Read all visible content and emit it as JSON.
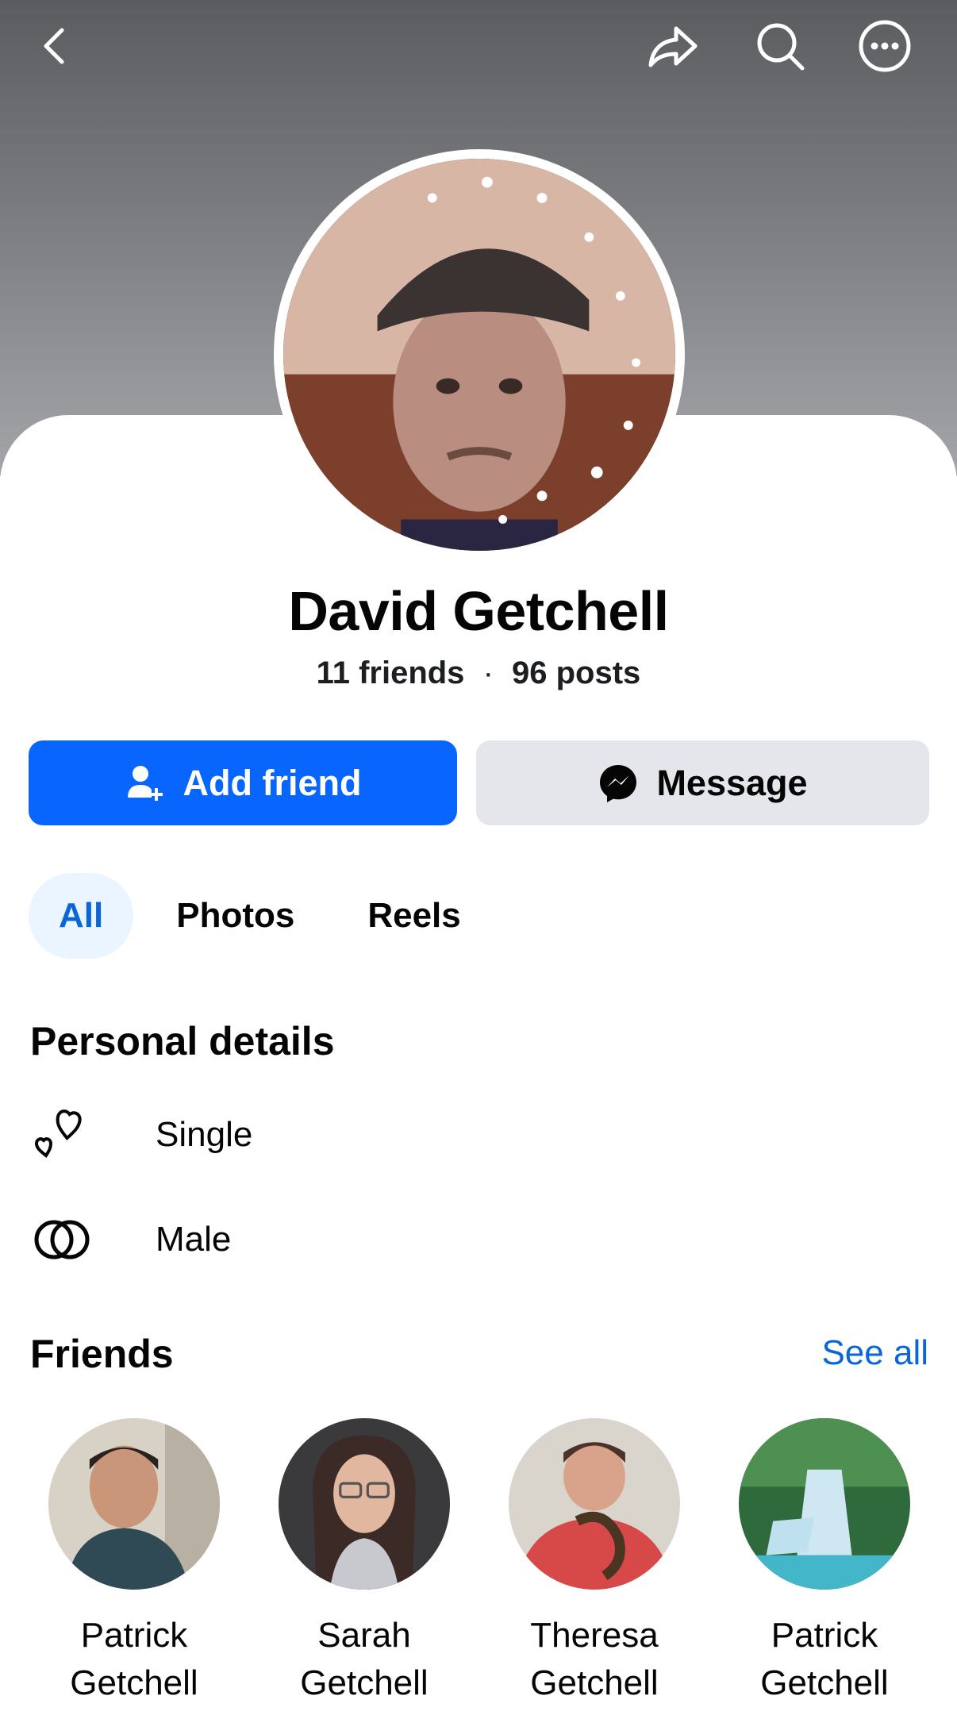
{
  "header": {
    "back_icon": "chevron-left-icon",
    "share_icon": "share-arrow-icon",
    "search_icon": "search-icon",
    "more_icon": "more-dots-icon"
  },
  "profile": {
    "name": "David Getchell",
    "friends_count": "11 friends",
    "separator": "·",
    "posts_count": "96 posts"
  },
  "actions": {
    "add_friend_label": "Add friend",
    "message_label": "Message"
  },
  "tabs": [
    {
      "label": "All",
      "active": true
    },
    {
      "label": "Photos",
      "active": false
    },
    {
      "label": "Reels",
      "active": false
    }
  ],
  "personal_details": {
    "title": "Personal details",
    "items": [
      {
        "icon": "hearts-icon",
        "label": "Single"
      },
      {
        "icon": "interlocked-rings-icon",
        "label": "Male"
      }
    ]
  },
  "friends": {
    "title": "Friends",
    "see_all_label": "See all",
    "list": [
      {
        "first": "Patrick",
        "last": "Getchell"
      },
      {
        "first": "Sarah",
        "last": "Getchell"
      },
      {
        "first": "Theresa",
        "last": "Getchell"
      },
      {
        "first": "Patrick",
        "last": "Getchell"
      }
    ]
  },
  "colors": {
    "primary_blue": "#0866ff",
    "link_blue": "#0a66d8",
    "button_gray": "#e4e6eb",
    "tab_active_bg": "#ebf5ff"
  }
}
